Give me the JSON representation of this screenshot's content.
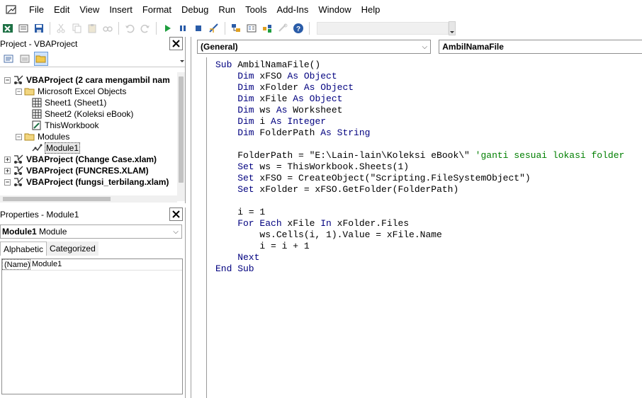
{
  "menu": {
    "items": [
      "File",
      "Edit",
      "View",
      "Insert",
      "Format",
      "Debug",
      "Run",
      "Tools",
      "Add-Ins",
      "Window",
      "Help"
    ]
  },
  "toolbar": {
    "buttons": [
      "excel-icon",
      "insert-module-icon",
      "save-icon",
      "cut-icon",
      "copy-icon",
      "paste-icon",
      "find-icon",
      "undo-icon",
      "redo-icon",
      "run-icon",
      "break-icon",
      "reset-icon",
      "design-mode-icon",
      "project-explorer-icon",
      "properties-icon",
      "object-browser-icon",
      "toolbox-icon",
      "help-icon"
    ]
  },
  "project_pane": {
    "title": "Project - VBAProject",
    "close": "✕",
    "tree": [
      {
        "label": "VBAProject (2 cara mengambil nam",
        "level": 0,
        "exp": "−",
        "icon": "vba-project-icon",
        "bold": true
      },
      {
        "label": "Microsoft Excel Objects",
        "level": 1,
        "exp": "−",
        "icon": "folder-icon",
        "bold": false
      },
      {
        "label": "Sheet1 (Sheet1)",
        "level": 2,
        "exp": "",
        "icon": "sheet-icon",
        "bold": false
      },
      {
        "label": "Sheet2 (Koleksi eBook)",
        "level": 2,
        "exp": "",
        "icon": "sheet-icon",
        "bold": false
      },
      {
        "label": "ThisWorkbook",
        "level": 2,
        "exp": "",
        "icon": "workbook-icon",
        "bold": false
      },
      {
        "label": "Modules",
        "level": 1,
        "exp": "−",
        "icon": "folder-icon",
        "bold": false
      },
      {
        "label": "Module1",
        "level": 2,
        "exp": "",
        "icon": "module-icon",
        "bold": false,
        "selected": true
      },
      {
        "label": "VBAProject (Change Case.xlam)",
        "level": 0,
        "exp": "+",
        "icon": "vba-project-icon",
        "bold": true
      },
      {
        "label": "VBAProject (FUNCRES.XLAM)",
        "level": 0,
        "exp": "+",
        "icon": "vba-project-icon",
        "bold": true
      },
      {
        "label": "VBAProject (fungsi_terbilang.xlam)",
        "level": 0,
        "exp": "−",
        "icon": "vba-project-icon",
        "bold": true
      }
    ]
  },
  "properties_pane": {
    "title": "Properties - Module1",
    "close": "✕",
    "object_name": "Module1",
    "object_type": "Module",
    "tabs": [
      "Alphabetic",
      "Categorized"
    ],
    "rows": [
      {
        "name": "(Name)",
        "value": "Module1"
      }
    ]
  },
  "code_window": {
    "object_combo": "(General)",
    "procedure_combo": "AmbilNamaFile",
    "lines": [
      [
        {
          "t": "Sub ",
          "k": "kw"
        },
        {
          "t": "AmbilNamaFile()",
          "k": ""
        }
      ],
      [
        {
          "t": "    Dim ",
          "k": "kw"
        },
        {
          "t": "xFSO ",
          "k": ""
        },
        {
          "t": "As Object",
          "k": "kw"
        }
      ],
      [
        {
          "t": "    Dim ",
          "k": "kw"
        },
        {
          "t": "xFolder ",
          "k": ""
        },
        {
          "t": "As Object",
          "k": "kw"
        }
      ],
      [
        {
          "t": "    Dim ",
          "k": "kw"
        },
        {
          "t": "xFile ",
          "k": ""
        },
        {
          "t": "As Object",
          "k": "kw"
        }
      ],
      [
        {
          "t": "    Dim ",
          "k": "kw"
        },
        {
          "t": "ws ",
          "k": ""
        },
        {
          "t": "As ",
          "k": "kw"
        },
        {
          "t": "Worksheet",
          "k": ""
        }
      ],
      [
        {
          "t": "    Dim ",
          "k": "kw"
        },
        {
          "t": "i ",
          "k": ""
        },
        {
          "t": "As Integer",
          "k": "kw"
        }
      ],
      [
        {
          "t": "    Dim ",
          "k": "kw"
        },
        {
          "t": "FolderPath ",
          "k": ""
        },
        {
          "t": "As String",
          "k": "kw"
        }
      ],
      [
        {
          "t": "",
          "k": ""
        }
      ],
      [
        {
          "t": "    FolderPath = \"E:\\Lain-lain\\Koleksi eBook\\\" ",
          "k": ""
        },
        {
          "t": "'ganti sesuai lokasi folder",
          "k": "cm"
        }
      ],
      [
        {
          "t": "    Set ",
          "k": "kw"
        },
        {
          "t": "ws = ThisWorkbook.Sheets(1)",
          "k": ""
        }
      ],
      [
        {
          "t": "    Set ",
          "k": "kw"
        },
        {
          "t": "xFSO = CreateObject(\"Scripting.FileSystemObject\")",
          "k": ""
        }
      ],
      [
        {
          "t": "    Set ",
          "k": "kw"
        },
        {
          "t": "xFolder = xFSO.GetFolder(FolderPath)",
          "k": ""
        }
      ],
      [
        {
          "t": "",
          "k": ""
        }
      ],
      [
        {
          "t": "    i = 1",
          "k": ""
        }
      ],
      [
        {
          "t": "    For Each ",
          "k": "kw"
        },
        {
          "t": "xFile ",
          "k": ""
        },
        {
          "t": "In ",
          "k": "kw"
        },
        {
          "t": "xFolder.Files",
          "k": ""
        }
      ],
      [
        {
          "t": "        ws.Cells(i, 1).Value = xFile.Name",
          "k": ""
        }
      ],
      [
        {
          "t": "        i = i + 1",
          "k": ""
        }
      ],
      [
        {
          "t": "    Next",
          "k": "kw"
        }
      ],
      [
        {
          "t": "End Sub",
          "k": "kw"
        }
      ]
    ]
  },
  "colors": {
    "keyword": "#00007f",
    "comment": "#007f00"
  }
}
